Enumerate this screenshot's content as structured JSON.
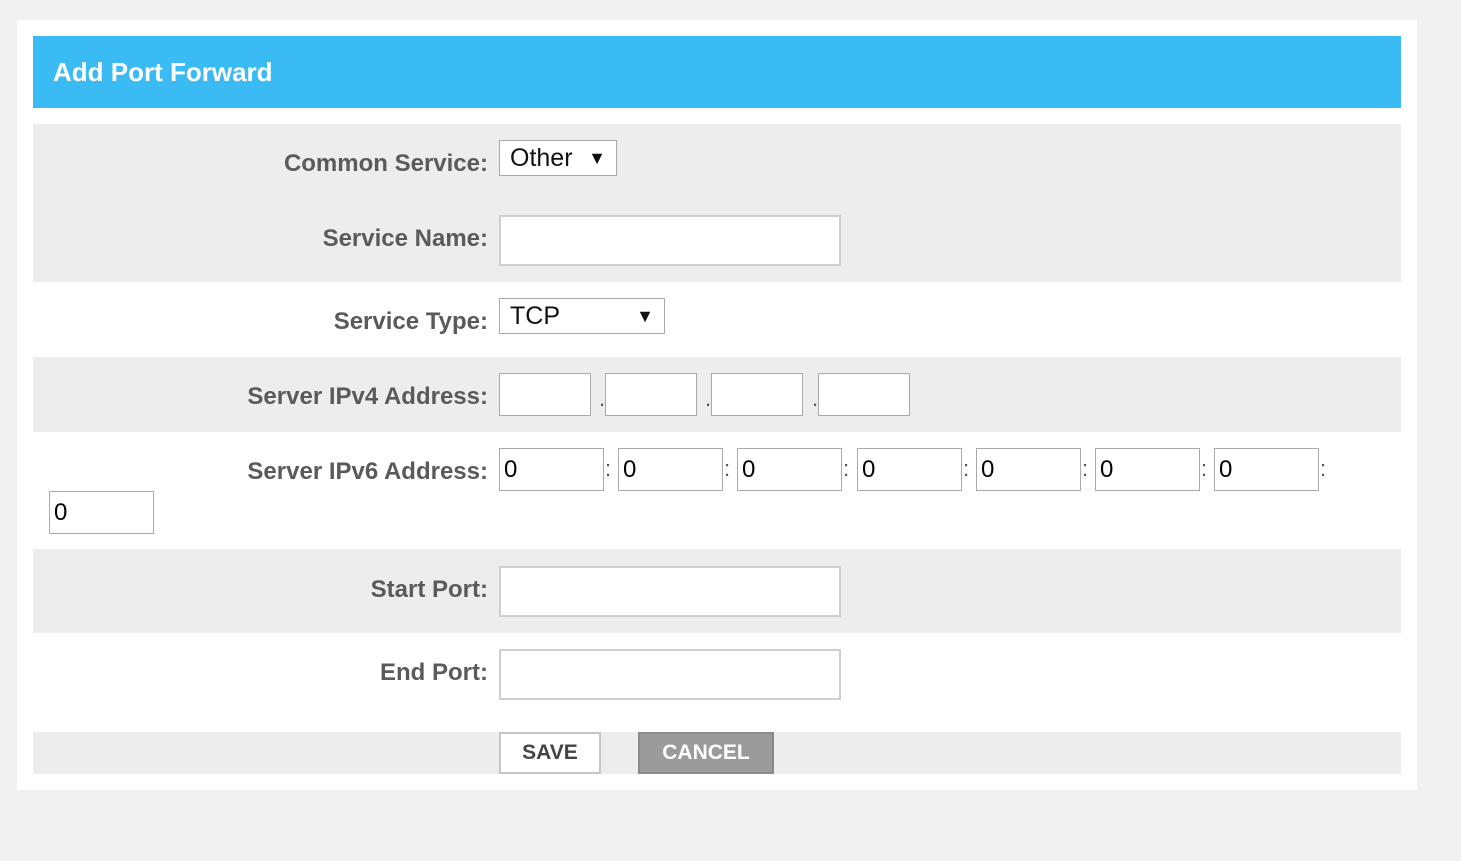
{
  "header": {
    "title": "Add Port Forward"
  },
  "form": {
    "common_service": {
      "label": "Common Service:",
      "value": "Other"
    },
    "service_name": {
      "label": "Service Name:",
      "value": ""
    },
    "service_type": {
      "label": "Service Type:",
      "value": "TCP"
    },
    "server_ipv4": {
      "label": "Server IPv4 Address:",
      "octets": [
        "",
        "",
        "",
        ""
      ],
      "separator": "."
    },
    "server_ipv6": {
      "label": "Server IPv6 Address:",
      "groups": [
        "0",
        "0",
        "0",
        "0",
        "0",
        "0",
        "0",
        "0"
      ],
      "separator": ":"
    },
    "start_port": {
      "label": "Start Port:",
      "value": ""
    },
    "end_port": {
      "label": "End Port:",
      "value": ""
    }
  },
  "actions": {
    "save_label": "SAVE",
    "cancel_label": "CANCEL"
  },
  "icons": {
    "dropdown_arrow": "▼"
  },
  "colors": {
    "header_bg": "#3bbbf3",
    "band_bg": "#ededed",
    "cancel_bg": "#9b9b9b"
  }
}
